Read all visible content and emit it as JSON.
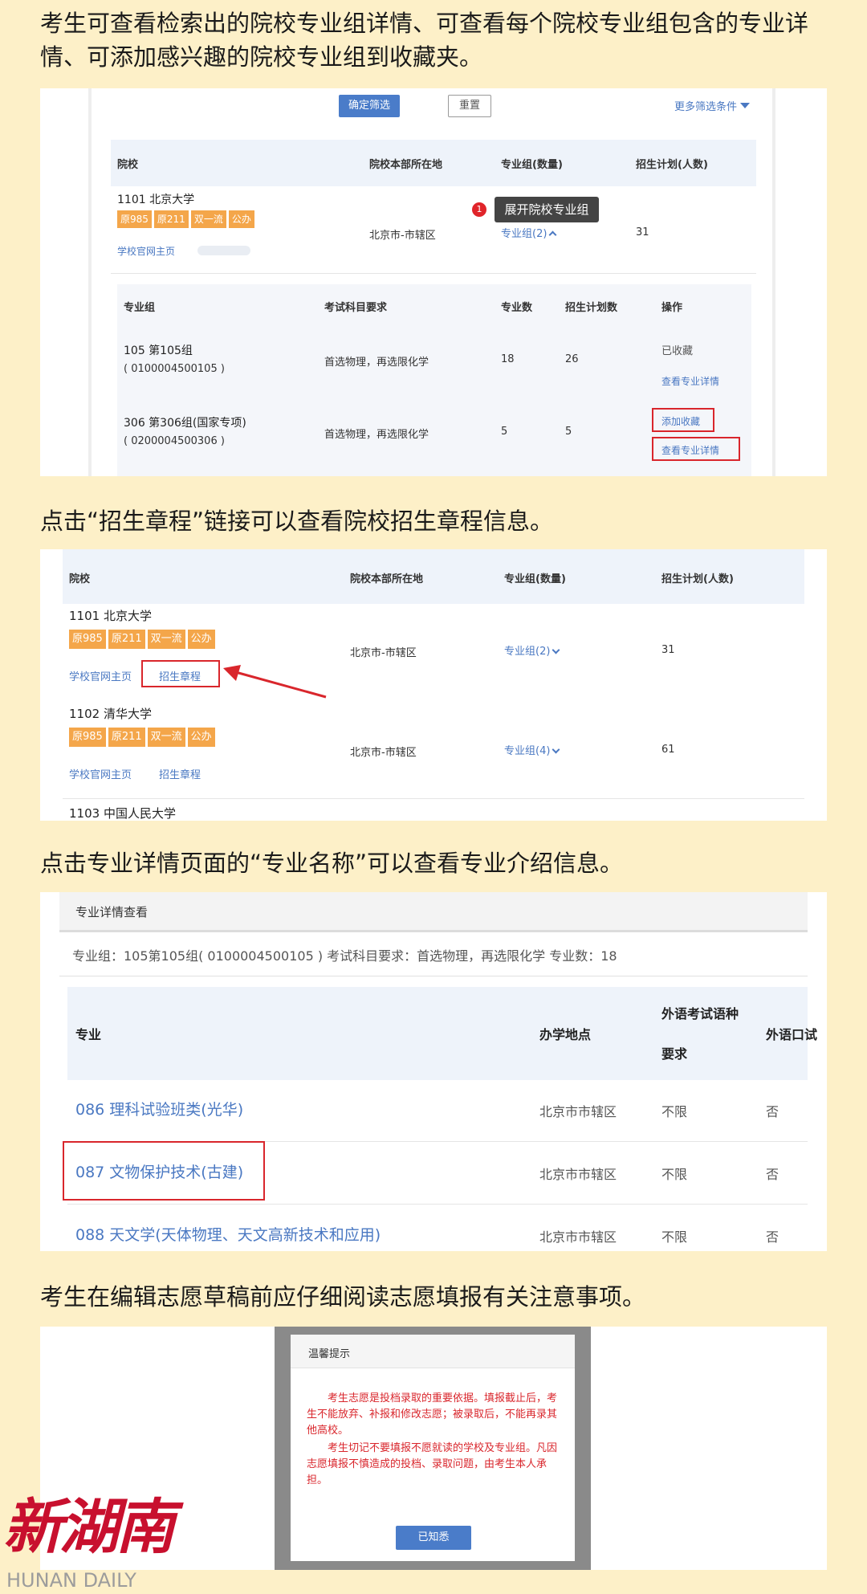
{
  "captions": {
    "c1": "考生可查看检索出的院校专业组详情、可查看每个院校专业组包含的专业详情、可添加感兴趣的院校专业组到收藏夹。",
    "c2": "点击“招生章程”链接可以查看院校招生章程信息。",
    "c3": "点击专业详情页面的“专业名称”可以查看专业介绍信息。",
    "c4": "考生在编辑志愿草稿前应仔细阅读志愿填报有关注意事项。"
  },
  "shot1": {
    "confirm_filter": "确定筛选",
    "reset": "重置",
    "more_filters": "更多筛选条件",
    "headers": {
      "school": "院校",
      "location": "院校本部所在地",
      "groups": "专业组(数量)",
      "plan": "招生计划(人数)"
    },
    "school": {
      "name": "1101 北京大学",
      "tags": [
        "原985",
        "原211",
        "双一流",
        "公办"
      ],
      "homepage": "学校官网主页",
      "location": "北京市-市辖区",
      "groups": "专业组(2)",
      "plan": "31"
    },
    "tooltip_badge": "1",
    "tooltip": "展开院校专业组",
    "sub_headers": {
      "group": "专业组",
      "subjects": "考试科目要求",
      "majors": "专业数",
      "plan": "招生计划数",
      "ops": "操作"
    },
    "rows": [
      {
        "name": "105 第105组",
        "code": "( 0100004500105 )",
        "subjects": "首选物理，再选限化学",
        "majors": "18",
        "plan": "26",
        "op1": "已收藏",
        "op2": "查看专业详情"
      },
      {
        "name": "306 第306组(国家专项)",
        "code": "( 0200004500306 )",
        "subjects": "首选物理，再选限化学",
        "majors": "5",
        "plan": "5",
        "op1": "添加收藏",
        "op2": "查看专业详情"
      }
    ]
  },
  "shot2": {
    "headers": {
      "school": "院校",
      "location": "院校本部所在地",
      "groups": "专业组(数量)",
      "plan": "招生计划(人数)"
    },
    "schools": [
      {
        "name": "1101 北京大学",
        "tags": [
          "原985",
          "原211",
          "双一流",
          "公办"
        ],
        "homepage": "学校官网主页",
        "charter": "招生章程",
        "location": "北京市-市辖区",
        "groups": "专业组(2)",
        "plan": "31"
      },
      {
        "name": "1102 清华大学",
        "tags": [
          "原985",
          "原211",
          "双一流",
          "公办"
        ],
        "homepage": "学校官网主页",
        "charter": "招生章程",
        "location": "北京市-市辖区",
        "groups": "专业组(4)",
        "plan": "61"
      }
    ],
    "partial": "1103 中国人民大学"
  },
  "shot3": {
    "title": "专业详情查看",
    "info": "专业组：105第105组( 0100004500105 )  考试科目要求：首选物理，再选限化学  专业数：18",
    "headers": {
      "major": "专业",
      "location": "办学地点",
      "lang_req_1": "外语考试语种",
      "lang_req_2": "要求",
      "oral": "外语口试"
    },
    "rows": [
      {
        "major": "086 理科试验班类(光华)",
        "location": "北京市市辖区",
        "lang": "不限",
        "oral": "否"
      },
      {
        "major": "087 文物保护技术(古建)",
        "location": "北京市市辖区",
        "lang": "不限",
        "oral": "否"
      },
      {
        "major": "088 天文学(天体物理、天文高新技术和应用)",
        "location": "北京市市辖区",
        "lang": "不限",
        "oral": "否"
      }
    ]
  },
  "shot4": {
    "dialog_title": "温馨提示",
    "para1": "考生志愿是投档录取的重要依据。填报截止后，考生不能放弃、补报和修改志愿；被录取后，不能再录其他高校。",
    "para2": "考生切记不要填报不愿就读的学校及专业组。凡因志愿填报不慎造成的投档、录取问题，由考生本人承担。",
    "ack": "已知悉"
  },
  "watermark": {
    "logo": "新湖南",
    "sub": "HUNAN DAILY"
  },
  "colors": {
    "link": "#4a78c2",
    "tag": "#f4a64a",
    "red": "#d9262c",
    "button": "#4a7cc9"
  }
}
